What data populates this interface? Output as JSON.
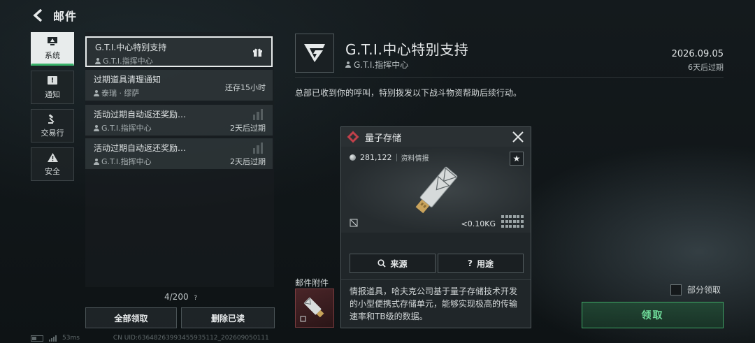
{
  "header": {
    "title": "邮件"
  },
  "nav": [
    {
      "label": "系统",
      "icon": "monitor-icon",
      "active": true
    },
    {
      "label": "通知",
      "icon": "exclamation-icon"
    },
    {
      "label": "交易行",
      "icon": "gavel-icon"
    },
    {
      "label": "安全",
      "icon": "warning-icon"
    }
  ],
  "mails": [
    {
      "title": "G.T.I.中心特别支持",
      "sender": "G.T.I.指挥中心",
      "right": "",
      "badge": "gift-icon"
    },
    {
      "title": "过期道具清理通知",
      "sender": "泰瑞 · 缪萨",
      "right": "还存15小时",
      "badge": ""
    },
    {
      "title": "活动过期自动返还奖励…",
      "sender": "G.T.I.指挥中心",
      "right": "2天后过期",
      "badge": "bars-icon"
    },
    {
      "title": "活动过期自动返还奖励…",
      "sender": "G.T.I.指挥中心",
      "right": "2天后过期",
      "badge": "bars-icon"
    }
  ],
  "list_footer": {
    "count": "4/200",
    "help": "?"
  },
  "buttons": {
    "claim_all": "全部领取",
    "delete_read": "删除已读"
  },
  "status": {
    "ping": "53ms",
    "uid": "CN UID:63648263993455935112_202609050111"
  },
  "detail": {
    "title": "G.T.I.中心特别支持",
    "sender": "G.T.I.指挥中心",
    "date": "2026.09.05",
    "expire": "6天后过期",
    "body": "总部已收到你的呼叫，特别拨发以下战斗物资帮助后续行动。",
    "attachments_label": "邮件附件",
    "partial_claim": "部分领取",
    "claim": "领取"
  },
  "popup": {
    "title": "量子存储",
    "value": "281,122",
    "category": "资料情报",
    "weight": "<0.10KG",
    "source_btn": "来源",
    "usage_btn": "用途",
    "description": "情报道具，哈夫克公司基于量子存储技术开发的小型便携式存储单元，能够实现极高的传输速率和TB级的数据。"
  },
  "colors": {
    "accent_green": "#3fa866",
    "item_red": "#c0404a"
  }
}
